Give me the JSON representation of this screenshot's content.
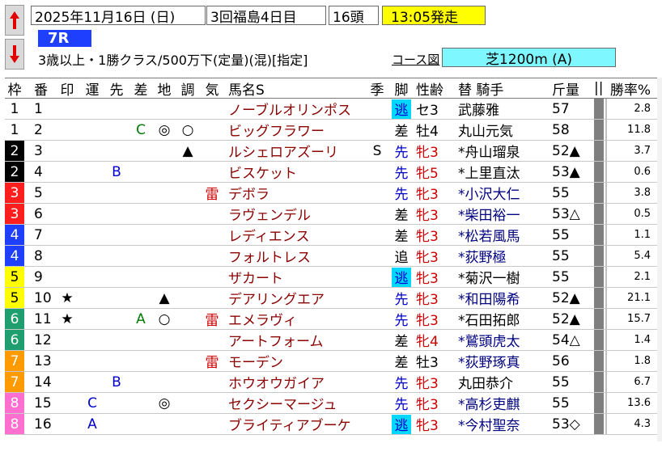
{
  "header": {
    "date": "2025年11月16日 (日)",
    "meeting": "3回福島4日目",
    "heads": "16頭",
    "start_time": "13:05発走",
    "race_no": "7R",
    "conditions": "3歳以上・1勝クラス/500万下(定量)(混)[指定]",
    "course_link": "コース図",
    "course": "芝1200m (A)",
    "up_icon": "arrow-up-icon",
    "down_icon": "arrow-down-icon"
  },
  "columns": {
    "waku": "枠",
    "ban": "番",
    "shirushi": "印",
    "un": "運",
    "saki": "先",
    "sa": "差",
    "chi": "地",
    "cho": "調",
    "ki": "気",
    "name": "馬名S",
    "kisetsu": "季",
    "kyaku": "脚",
    "seirei": "性齢",
    "kishu": "替 騎手",
    "kinryo": "斤量",
    "divider": "||",
    "rate": "勝率%"
  },
  "colors": {
    "waku": {
      "1": {
        "bg": "#ffffff",
        "fg": "#000000"
      },
      "2": {
        "bg": "#000000",
        "fg": "#ffffff"
      },
      "3": {
        "bg": "#ff1e1e",
        "fg": "#ffffff"
      },
      "4": {
        "bg": "#1f3fff",
        "fg": "#ffffff"
      },
      "5": {
        "bg": "#ffff00",
        "fg": "#000000"
      },
      "6": {
        "bg": "#1f9f6f",
        "fg": "#ffffff"
      },
      "7": {
        "bg": "#ff9a00",
        "fg": "#ffffff"
      },
      "8": {
        "bg": "#ff6fcf",
        "fg": "#ffffff"
      }
    },
    "nige_bg": "#00d8ff",
    "accent_start": "#ffff00",
    "course_bg": "#7ff7ff"
  },
  "horses": [
    {
      "waku": "1",
      "ban": "1",
      "shirushi": "",
      "un": "",
      "saki": "",
      "sa": "",
      "chi": "",
      "cho": "",
      "ki": "",
      "name": "ノーブルオリンポス",
      "kisetsu": "",
      "kyaku": "逃",
      "kyaku_type": "nige",
      "seirei": "セ3",
      "seirei_color": "black",
      "kishu": "武藤雅",
      "kishu_color": "black",
      "kinryo": "57",
      "rate": "2.8"
    },
    {
      "waku": "1",
      "ban": "2",
      "shirushi": "",
      "un": "",
      "saki": "",
      "sa": "C",
      "chi": "◎",
      "cho": "○",
      "ki": "",
      "name": "ビッグフラワー",
      "kisetsu": "",
      "kyaku": "差",
      "kyaku_type": "sashi",
      "seirei": "牡4",
      "seirei_color": "black",
      "kishu": "丸山元気",
      "kishu_color": "black",
      "kinryo": "58",
      "rate": "11.8"
    },
    {
      "waku": "2",
      "ban": "3",
      "shirushi": "",
      "un": "",
      "saki": "",
      "sa": "",
      "chi": "",
      "cho": "▲",
      "ki": "",
      "name": "ルシェロアズーリ",
      "kisetsu": "S",
      "kyaku": "先",
      "kyaku_type": "senko",
      "seirei": "牝3",
      "seirei_color": "red",
      "kishu": "*舟山瑠泉",
      "kishu_color": "black",
      "kinryo": "52▲",
      "rate": "3.7"
    },
    {
      "waku": "2",
      "ban": "4",
      "shirushi": "",
      "un": "",
      "saki": "B",
      "sa": "",
      "chi": "",
      "cho": "",
      "ki": "",
      "name": "ビスケット",
      "kisetsu": "",
      "kyaku": "先",
      "kyaku_type": "senko",
      "seirei": "牝5",
      "seirei_color": "red",
      "kishu": "*上里直汰",
      "kishu_color": "black",
      "kinryo": "53▲",
      "rate": "0.6"
    },
    {
      "waku": "3",
      "ban": "5",
      "shirushi": "",
      "un": "",
      "saki": "",
      "sa": "",
      "chi": "",
      "cho": "",
      "ki": "雷",
      "name": "デボラ",
      "kisetsu": "",
      "kyaku": "先",
      "kyaku_type": "senko",
      "seirei": "牝3",
      "seirei_color": "red",
      "kishu": "*小沢大仁",
      "kishu_color": "navy",
      "kinryo": "55",
      "rate": "3.8"
    },
    {
      "waku": "3",
      "ban": "6",
      "shirushi": "",
      "un": "",
      "saki": "",
      "sa": "",
      "chi": "",
      "cho": "",
      "ki": "",
      "name": "ラヴェンデル",
      "kisetsu": "",
      "kyaku": "差",
      "kyaku_type": "sashi",
      "seirei": "牝3",
      "seirei_color": "red",
      "kishu": "*柴田裕一",
      "kishu_color": "navy",
      "kinryo": "53△",
      "rate": "0.5"
    },
    {
      "waku": "4",
      "ban": "7",
      "shirushi": "",
      "un": "",
      "saki": "",
      "sa": "",
      "chi": "",
      "cho": "",
      "ki": "",
      "name": "レディエンス",
      "kisetsu": "",
      "kyaku": "差",
      "kyaku_type": "sashi",
      "seirei": "牝3",
      "seirei_color": "red",
      "kishu": "*松若風馬",
      "kishu_color": "navy",
      "kinryo": "55",
      "rate": "1.1"
    },
    {
      "waku": "4",
      "ban": "8",
      "shirushi": "",
      "un": "",
      "saki": "",
      "sa": "",
      "chi": "",
      "cho": "",
      "ki": "",
      "name": "フォルトレス",
      "kisetsu": "",
      "kyaku": "追",
      "kyaku_type": "oikomi",
      "seirei": "牝3",
      "seirei_color": "red",
      "kishu": "*荻野極",
      "kishu_color": "navy",
      "kinryo": "55",
      "rate": "5.4"
    },
    {
      "waku": "5",
      "ban": "9",
      "shirushi": "",
      "un": "",
      "saki": "",
      "sa": "",
      "chi": "",
      "cho": "",
      "ki": "",
      "name": "ザカート",
      "kisetsu": "",
      "kyaku": "逃",
      "kyaku_type": "nige",
      "seirei": "牝3",
      "seirei_color": "red",
      "kishu": "*菊沢一樹",
      "kishu_color": "black",
      "kinryo": "55",
      "rate": "2.1"
    },
    {
      "waku": "5",
      "ban": "10",
      "shirushi": "★",
      "un": "",
      "saki": "",
      "sa": "",
      "chi": "▲",
      "cho": "",
      "ki": "",
      "name": "デアリングエア",
      "kisetsu": "",
      "kyaku": "先",
      "kyaku_type": "senko",
      "seirei": "牝3",
      "seirei_color": "red",
      "kishu": "*和田陽希",
      "kishu_color": "navy",
      "kinryo": "52▲",
      "rate": "21.1"
    },
    {
      "waku": "6",
      "ban": "11",
      "shirushi": "★",
      "un": "",
      "saki": "",
      "sa": "A",
      "chi": "○",
      "cho": "",
      "ki": "雷",
      "name": "エメラヴィ",
      "kisetsu": "",
      "kyaku": "先",
      "kyaku_type": "senko",
      "seirei": "牝3",
      "seirei_color": "red",
      "kishu": "*石田拓郎",
      "kishu_color": "black",
      "kinryo": "52▲",
      "rate": "15.7"
    },
    {
      "waku": "6",
      "ban": "12",
      "shirushi": "",
      "un": "",
      "saki": "",
      "sa": "",
      "chi": "",
      "cho": "",
      "ki": "",
      "name": "アートフォーム",
      "kisetsu": "",
      "kyaku": "差",
      "kyaku_type": "sashi",
      "seirei": "牝4",
      "seirei_color": "red",
      "kishu": "*鷲頭虎太",
      "kishu_color": "navy",
      "kinryo": "54△",
      "rate": "1.4"
    },
    {
      "waku": "7",
      "ban": "13",
      "shirushi": "",
      "un": "",
      "saki": "",
      "sa": "",
      "chi": "",
      "cho": "",
      "ki": "雷",
      "name": "モーデン",
      "kisetsu": "",
      "kyaku": "差",
      "kyaku_type": "sashi",
      "seirei": "牡3",
      "seirei_color": "black",
      "kishu": "*荻野琢真",
      "kishu_color": "navy",
      "kinryo": "56",
      "rate": "1.8"
    },
    {
      "waku": "7",
      "ban": "14",
      "shirushi": "",
      "un": "",
      "saki": "B",
      "sa": "",
      "chi": "",
      "cho": "",
      "ki": "",
      "name": "ホウオウガイア",
      "kisetsu": "",
      "kyaku": "先",
      "kyaku_type": "senko",
      "seirei": "牝3",
      "seirei_color": "red",
      "kishu": "丸田恭介",
      "kishu_color": "black",
      "kinryo": "55",
      "rate": "6.7"
    },
    {
      "waku": "8",
      "ban": "15",
      "shirushi": "",
      "un": "C",
      "saki": "",
      "sa": "",
      "chi": "◎",
      "cho": "",
      "ki": "",
      "name": "セクシーマージュ",
      "kisetsu": "",
      "kyaku": "先",
      "kyaku_type": "senko",
      "seirei": "牝3",
      "seirei_color": "red",
      "kishu": "*高杉吏麒",
      "kishu_color": "navy",
      "kinryo": "55",
      "rate": "13.6"
    },
    {
      "waku": "8",
      "ban": "16",
      "shirushi": "",
      "un": "A",
      "saki": "",
      "sa": "",
      "chi": "",
      "cho": "",
      "ki": "",
      "name": "ブライティアブーケ",
      "kisetsu": "",
      "kyaku": "逃",
      "kyaku_type": "nige",
      "seirei": "牝3",
      "seirei_color": "red",
      "kishu": "*今村聖奈",
      "kishu_color": "navy",
      "kinryo": "53◇",
      "rate": "4.3"
    }
  ]
}
